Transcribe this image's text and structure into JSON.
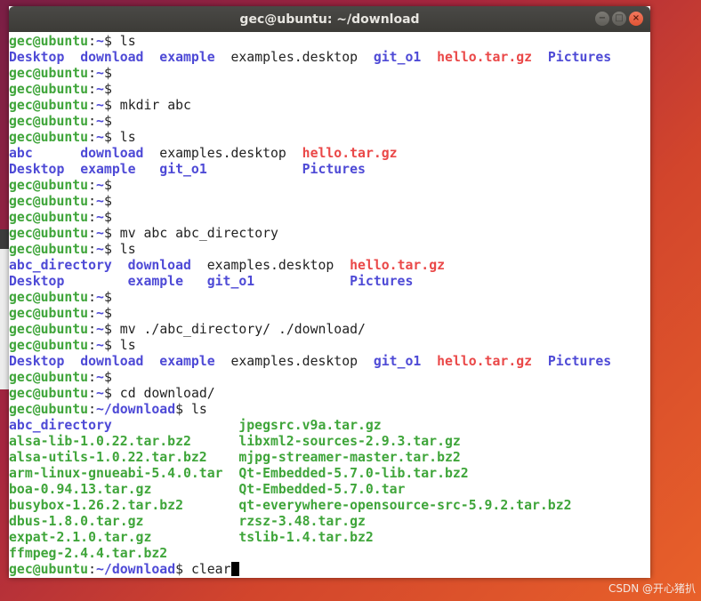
{
  "window": {
    "title": "gec@ubuntu: ~/download",
    "controls": {
      "minimize": "−",
      "maximize": "□",
      "close": "×"
    }
  },
  "prompt": {
    "user": "gec@ubuntu",
    "sep": ":",
    "home": "~",
    "download": "~/download",
    "dollar": "$"
  },
  "commands": {
    "ls": "ls",
    "mkdir": "mkdir abc",
    "mv1": "mv abc abc_directory",
    "mv2": "mv ./abc_directory/ ./download/",
    "cd": "cd download/",
    "clear": "clear"
  },
  "entries": {
    "Desktop": "Desktop",
    "download": "download",
    "example": "example",
    "examples_desktop": "examples.desktop",
    "git_o1": "git_o1",
    "hello": "hello.tar.gz",
    "Pictures": "Pictures",
    "abc": "abc",
    "abc_directory": "abc_directory"
  },
  "download_listing": {
    "left": [
      "abc_directory",
      "alsa-lib-1.0.22.tar.bz2",
      "alsa-utils-1.0.22.tar.bz2",
      "arm-linux-gnueabi-5.4.0.tar",
      "boa-0.94.13.tar.gz",
      "busybox-1.26.2.tar.bz2",
      "dbus-1.8.0.tar.gz",
      "expat-2.1.0.tar.gz",
      "ffmpeg-2.4.4.tar.bz2"
    ],
    "right": [
      "jpegsrc.v9a.tar.gz",
      "libxml2-sources-2.9.3.tar.gz",
      "mjpg-streamer-master.tar.bz2",
      "Qt-Embedded-5.7.0-lib.tar.bz2",
      "Qt-Embedded-5.7.0.tar",
      "qt-everywhere-opensource-src-5.9.2.tar.bz2",
      "rzsz-3.48.tar.gz",
      "tslib-1.4.tar.bz2"
    ]
  },
  "watermark": "CSDN @开心猪扒"
}
